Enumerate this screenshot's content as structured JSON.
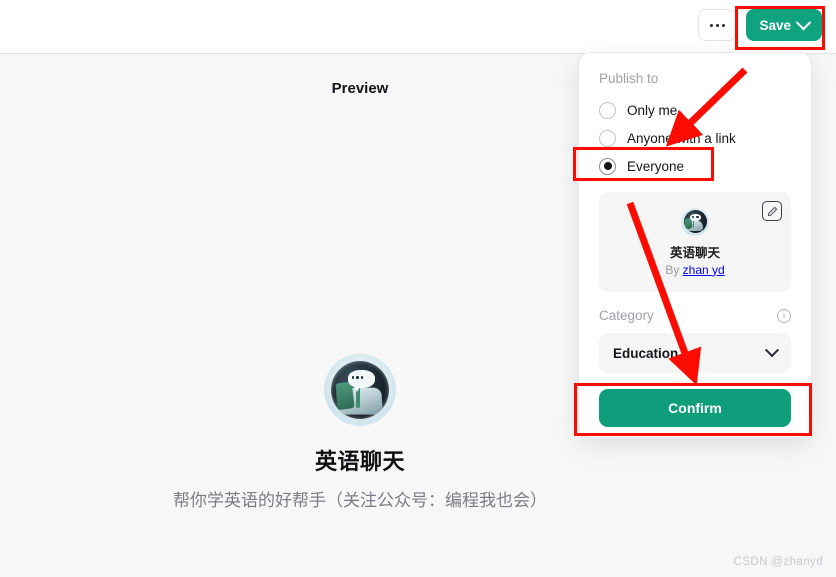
{
  "topbar": {
    "more_button_label": "more-options",
    "save_label": "Save",
    "save_chevron": "chevron-down-icon"
  },
  "preview": {
    "heading": "Preview",
    "gpt_name": "英语聊天",
    "gpt_description": "帮你学英语的好帮手（关注公众号：编程我也会）",
    "avatar_icon": "book-chat-avatar"
  },
  "publish_panel": {
    "section_label": "Publish to",
    "options": [
      {
        "label": "Only me",
        "selected": false
      },
      {
        "label": "Anyone with a link",
        "selected": false
      },
      {
        "label": "Everyone",
        "selected": true
      }
    ],
    "card": {
      "name": "英语聊天",
      "by_prefix": "By ",
      "author": "zhan yd",
      "edit_icon": "pencil-edit-icon",
      "avatar_icon": "book-chat-avatar"
    },
    "category": {
      "label": "Category",
      "info_icon": "info-circle-icon",
      "info_glyph": "i",
      "selected": "Education",
      "chevron": "chevron-down-icon"
    },
    "confirm_label": "Confirm"
  },
  "annotations": {
    "highlight_color": "#fb0c00",
    "boxes": [
      "save-button",
      "everyone-radio",
      "confirm-button"
    ],
    "arrows": [
      "arrow-to-everyone-option",
      "arrow-to-confirm-button"
    ]
  },
  "watermark": "CSDN @zhanyd",
  "colors": {
    "brand_green": "#10a37f",
    "confirm_green": "#0e9e7b",
    "page_background": "#f7f7f8",
    "annotation_red": "#fb0c00"
  }
}
